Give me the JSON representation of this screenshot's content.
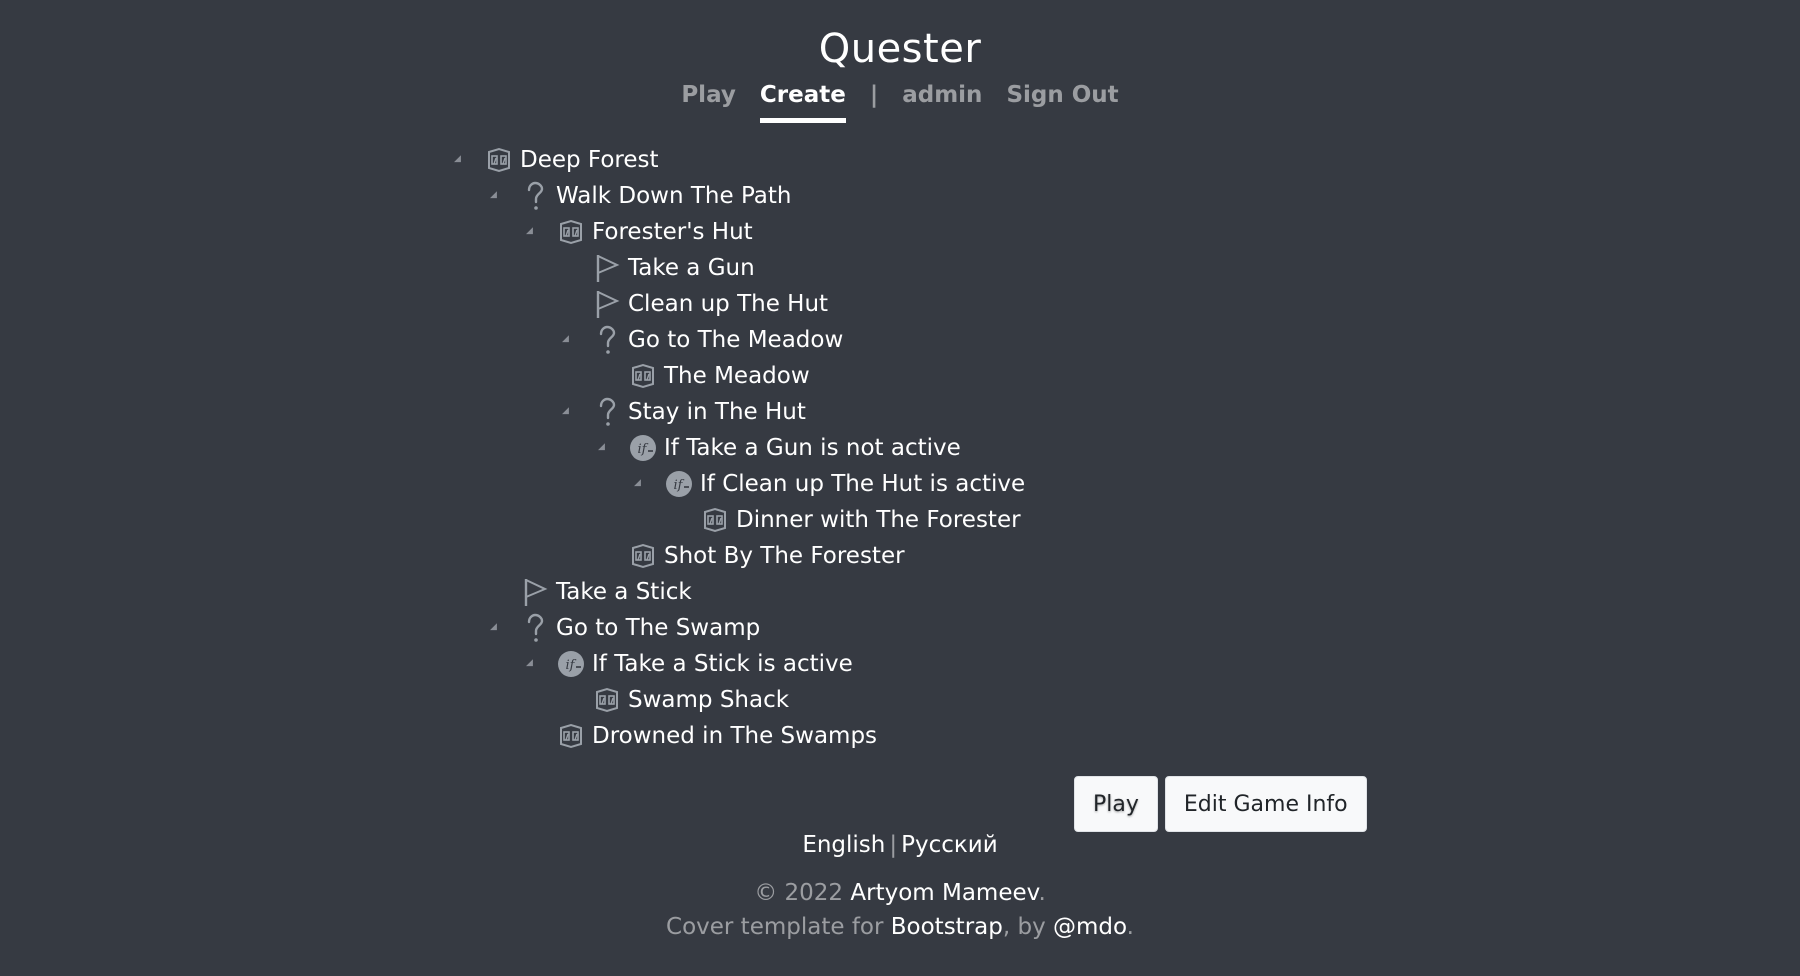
{
  "header": {
    "brand": "Quester",
    "nav": {
      "play": "Play",
      "create": "Create",
      "separator": "|",
      "user": "admin",
      "sign_out": "Sign Out"
    }
  },
  "tree": [
    {
      "label": "Deep Forest",
      "type": "scene",
      "depth": 0,
      "expandable": true
    },
    {
      "label": "Walk Down The Path",
      "type": "choice",
      "depth": 1,
      "expandable": true
    },
    {
      "label": "Forester's Hut",
      "type": "scene",
      "depth": 2,
      "expandable": true
    },
    {
      "label": "Take a Gun",
      "type": "flag",
      "depth": 3,
      "expandable": false
    },
    {
      "label": "Clean up The Hut",
      "type": "flag",
      "depth": 3,
      "expandable": false
    },
    {
      "label": "Go to The Meadow",
      "type": "choice",
      "depth": 3,
      "expandable": true
    },
    {
      "label": "The Meadow",
      "type": "scene",
      "depth": 4,
      "expandable": false
    },
    {
      "label": "Stay in The Hut",
      "type": "choice",
      "depth": 3,
      "expandable": true
    },
    {
      "label": "If Take a Gun is not active",
      "type": "condition",
      "depth": 4,
      "expandable": true
    },
    {
      "label": "If Clean up The Hut is active",
      "type": "condition",
      "depth": 5,
      "expandable": true
    },
    {
      "label": "Dinner with The Forester",
      "type": "scene",
      "depth": 6,
      "expandable": false
    },
    {
      "label": "Shot By The Forester",
      "type": "scene",
      "depth": 4,
      "expandable": false
    },
    {
      "label": "Take a Stick",
      "type": "flag",
      "depth": 1,
      "expandable": false
    },
    {
      "label": "Go to The Swamp",
      "type": "choice",
      "depth": 1,
      "expandable": true
    },
    {
      "label": "If Take a Stick is active",
      "type": "condition",
      "depth": 2,
      "expandable": true
    },
    {
      "label": "Swamp Shack",
      "type": "scene",
      "depth": 3,
      "expandable": false
    },
    {
      "label": "Drowned in The Swamps",
      "type": "scene",
      "depth": 2,
      "expandable": false
    }
  ],
  "icons": {
    "scene": "scene-icon",
    "choice": "question-mark-icon",
    "flag": "flag-icon",
    "condition": "condition-if-icon"
  },
  "actions": {
    "play": "Play",
    "edit_game_info": "Edit Game Info"
  },
  "footer": {
    "lang_en": "English",
    "lang_sep": "|",
    "lang_ru": "Русский",
    "copyright_prefix": "© 2022 ",
    "author": "Artyom Mameev",
    "copyright_suffix": ".",
    "cover_prefix": "Cover template for ",
    "bootstrap": "Bootstrap",
    "by": ", by ",
    "mdo": "@mdo",
    "cover_suffix": "."
  },
  "colors": {
    "background": "#363a42",
    "text": "#ffffff",
    "muted": "rgba(255,255,255,0.5)",
    "icon": "#9aa0a8"
  }
}
